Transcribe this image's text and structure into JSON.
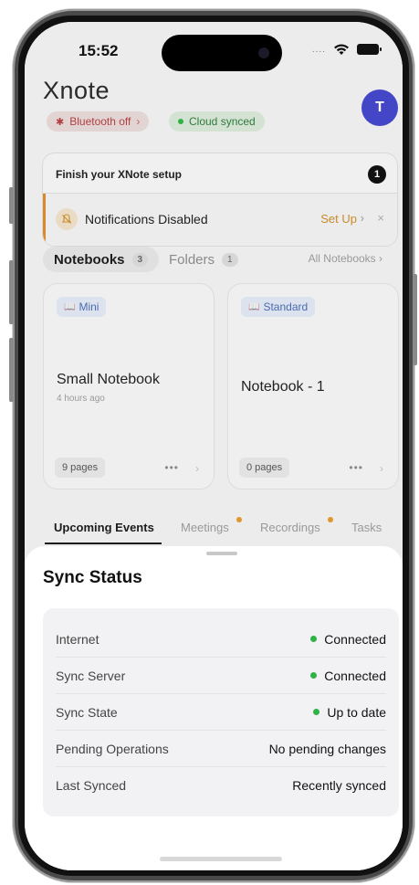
{
  "status_bar": {
    "time": "15:52",
    "signal": "...."
  },
  "header": {
    "brand": "Xnote",
    "avatar_initial": "T"
  },
  "chips": {
    "bluetooth": "Bluetooth off",
    "bluetooth_chevron": "›",
    "cloud": "Cloud synced"
  },
  "setup": {
    "title": "Finish your XNote setup",
    "badge": "1",
    "notification_label": "Notifications Disabled",
    "setup_link": "Set Up",
    "chevron": "›",
    "close": "×"
  },
  "notebook_tabs": {
    "notebooks_label": "Notebooks",
    "notebooks_count": "3",
    "folders_label": "Folders",
    "folders_count": "1",
    "all_link": "All Notebooks ›"
  },
  "notebooks": [
    {
      "tag": "Mini",
      "title": "Small Notebook",
      "time": "4 hours ago",
      "pages": "9 pages",
      "more": "•••",
      "chevron": "›"
    },
    {
      "tag": "Standard",
      "title": "Notebook - 1",
      "pages": "0 pages",
      "more": "•••",
      "chevron": "›"
    }
  ],
  "bottom_tabs": [
    {
      "label": "Upcoming Events"
    },
    {
      "label": "Meetings"
    },
    {
      "label": "Recordings"
    },
    {
      "label": "Tasks"
    }
  ],
  "sync_sheet": {
    "title": "Sync Status",
    "rows": [
      {
        "label": "Internet",
        "value": "Connected"
      },
      {
        "label": "Sync Server",
        "value": "Connected"
      },
      {
        "label": "Sync State",
        "value": "Up to date"
      },
      {
        "label": "Pending Operations",
        "value": "No pending changes"
      },
      {
        "label": "Last Synced",
        "value": "Recently synced"
      }
    ]
  },
  "colors": {
    "accent": "#4446c8",
    "connected_green": "#2fb344",
    "warning_orange": "#d98a2e",
    "error_red": "#b04040"
  },
  "icons": [
    "wifi-icon",
    "battery-icon",
    "bluetooth-off-icon",
    "bell-off-icon",
    "book-icon"
  ]
}
